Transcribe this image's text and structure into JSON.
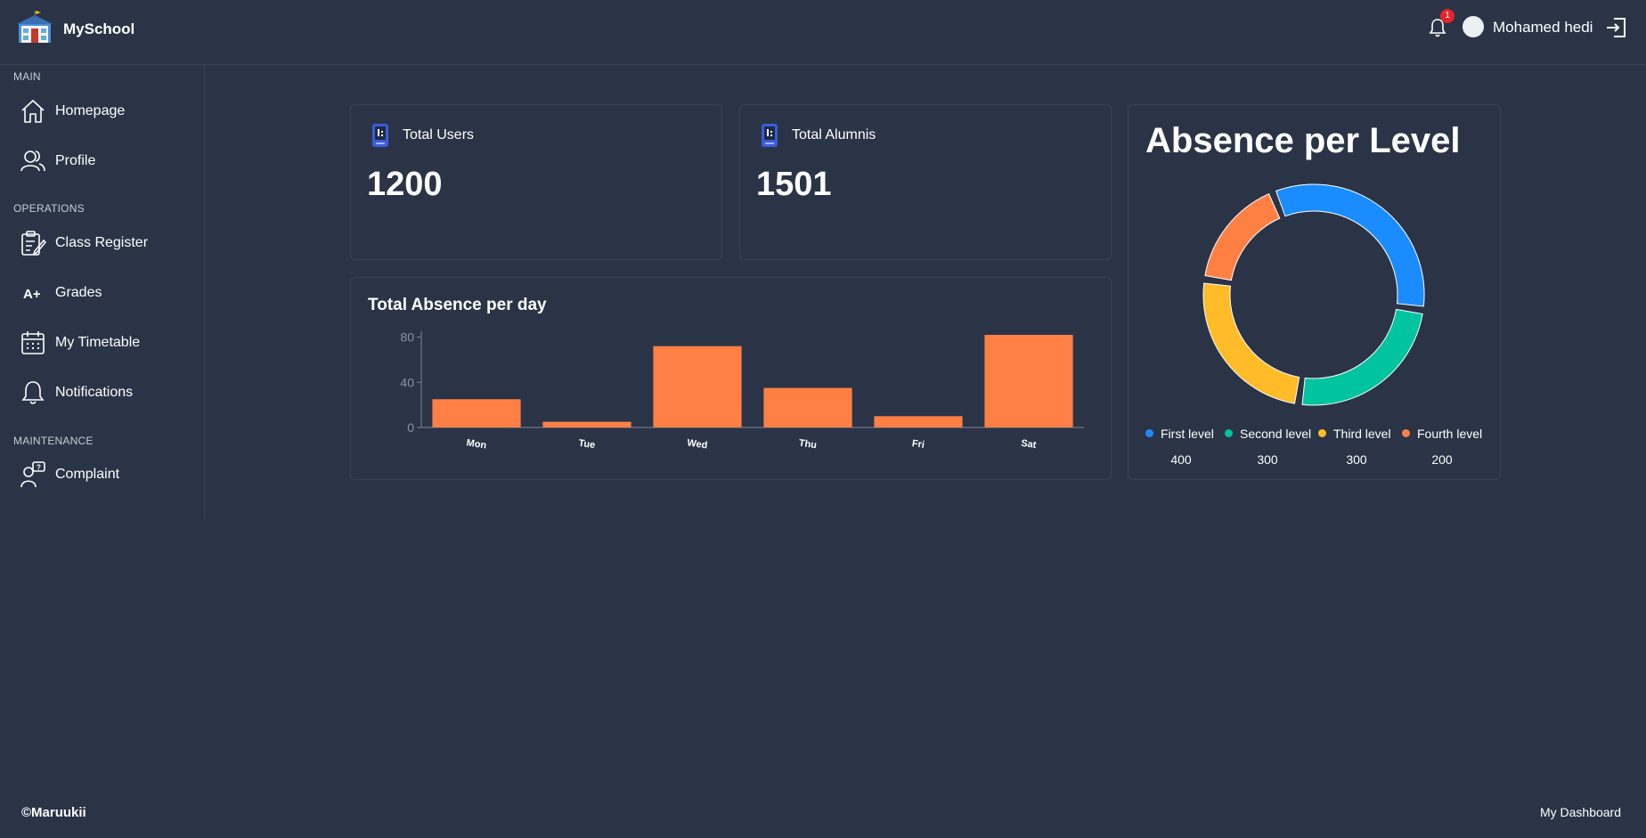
{
  "header": {
    "brand": "MySchool",
    "notification_count": "1",
    "user_name": "Mohamed hedi"
  },
  "sidebar": {
    "sections": [
      {
        "label": "MAIN"
      },
      {
        "label": "OPERATIONS"
      },
      {
        "label": "MAINTENANCE"
      }
    ],
    "items": [
      {
        "label": "Homepage",
        "icon": "home-icon"
      },
      {
        "label": "Profile",
        "icon": "users-icon"
      },
      {
        "label": "Class Register",
        "icon": "clipboard-edit-icon"
      },
      {
        "label": "Grades",
        "icon": "a-plus-icon"
      },
      {
        "label": "My Timetable",
        "icon": "calendar-icon"
      },
      {
        "label": "Notifications",
        "icon": "bell-icon"
      },
      {
        "label": "Complaint",
        "icon": "complaint-icon"
      }
    ]
  },
  "stats": [
    {
      "title": "Total Users",
      "value": "1200",
      "icon": "mobile-icon"
    },
    {
      "title": "Total Alumnis",
      "value": "1501",
      "icon": "mobile-icon"
    }
  ],
  "bar_chart": {
    "title": "Total Absence per day"
  },
  "donut_chart": {
    "title": "Absence per Level"
  },
  "chart_data": [
    {
      "type": "bar",
      "title": "Total Absence per day",
      "categories": [
        "Mon",
        "Tue",
        "Wed",
        "Thu",
        "Fri",
        "Sat"
      ],
      "values": [
        25,
        5,
        72,
        35,
        10,
        82
      ],
      "yticks": [
        0,
        40,
        80
      ],
      "ylim": [
        0,
        82
      ],
      "color": "#ff7f45",
      "grid": false
    },
    {
      "type": "pie",
      "title": "Absence per Level",
      "categories": [
        "First level",
        "Second level",
        "Third level",
        "Fourth level"
      ],
      "values": [
        400,
        300,
        300,
        200
      ],
      "colors": [
        "#1a8cff",
        "#00c49f",
        "#ffbb28",
        "#ff8042"
      ],
      "legend": "bottom"
    }
  ],
  "footer": {
    "copyright": "©Maruukii",
    "link": "My Dashboard"
  }
}
